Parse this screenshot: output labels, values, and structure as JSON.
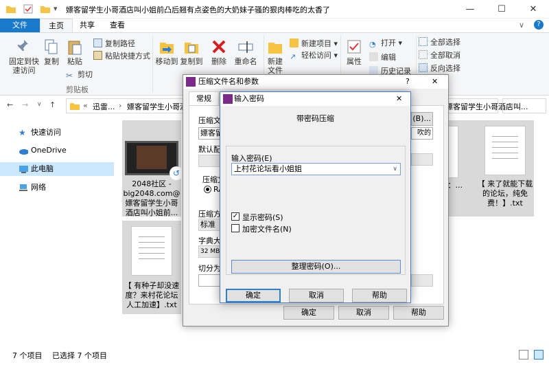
{
  "window": {
    "title": "嫖客留学生小哥酒店叫小姐前凸后翘有点姿色的大奶妹子骚的狠肉棒吃的太香了",
    "minimize": "—",
    "maximize": "☐",
    "close": "✕"
  },
  "ribbon_tabs": {
    "file": "文件",
    "home": "主页",
    "share": "共享",
    "view": "查看"
  },
  "ribbon": {
    "pin": "固定到快速访问",
    "copy": "复制",
    "paste": "粘贴",
    "copy_path": "复制路径",
    "paste_shortcut": "粘贴快捷方式",
    "cut": "剪切",
    "clipboard": "剪贴板",
    "move_to": "移动到",
    "copy_to": "复制到",
    "delete": "删除",
    "rename": "重命名",
    "new_folder": "新建文件夹",
    "new_item": "新建项目",
    "easy_access": "轻松访问",
    "properties": "属性",
    "open": "打开",
    "edit": "编辑",
    "history": "历史记录",
    "select_all": "全部选择",
    "select_none": "全部取消",
    "invert": "反向选择"
  },
  "address": {
    "crumb1": "迅雷...",
    "crumb2": "嫖客留学生小哥酒店...",
    "crumb3": "嫖客留学生小哥酒店叫..."
  },
  "nav": {
    "quick": "快速访问",
    "onedrive": "OneDrive",
    "pc": "此电脑",
    "network": "网络"
  },
  "files": [
    {
      "name": "2048社区 - big2048.com@嫖客留学生小哥酒店叫小姐前..."
    },
    {
      "name": "【 有种子却没速度？来村花论坛人工加速】.txt"
    },
    {
      "name": "【 来了就能下载的论坛，纯免费！】.txt"
    },
    {
      "name": "...：...小"
    }
  ],
  "status": {
    "count": "7 个项目",
    "selected": "已选择 7 个项目"
  },
  "archive_dialog": {
    "title": "压缩文件名和参数",
    "tab_general": "常规",
    "archive_name_label": "压缩文件",
    "archive_name": "嫖客留",
    "default_profile": "默认配",
    "format_label": "压缩文",
    "format_rar": "RA",
    "method_label": "压缩方",
    "method": "标准",
    "dict_label": "字典大",
    "dict": "32 MB",
    "split_label": "切分为",
    "browse": "(B)...",
    "right_field": "吹的",
    "ok": "确定",
    "cancel": "取消",
    "help": "帮助",
    "help_q": "?",
    "close": "✕"
  },
  "password_dialog": {
    "title": "输入密码",
    "header": "带密码压缩",
    "enter_label": "输入密码(E)",
    "password": "上村花论坛看小姐姐",
    "show_password": "显示密码(S)",
    "encrypt_names": "加密文件名(N)",
    "organize": "整理密码(O)...",
    "ok": "确定",
    "cancel": "取消",
    "help": "帮助",
    "close": "✕",
    "show_checked": true,
    "encrypt_checked": false
  }
}
